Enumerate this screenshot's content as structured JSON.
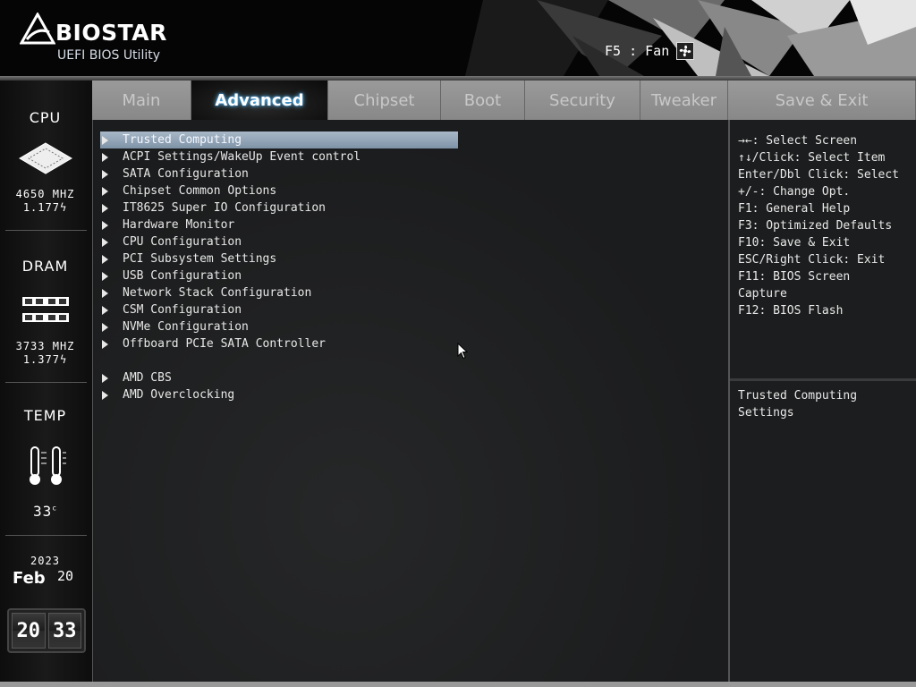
{
  "header": {
    "brand": "BIOSTAR",
    "subtitle": "UEFI BIOS Utility",
    "fan_hint": "F5 : Fan"
  },
  "status": {
    "cpu_label": "CPU",
    "cpu_freq": "4650 MHZ",
    "cpu_volt": "1.177",
    "dram_label": "DRAM",
    "dram_freq": "3733 MHZ",
    "dram_volt": "1.377",
    "temp_label": "TEMP",
    "temp_value": "33",
    "temp_unit": "c",
    "year": "2023",
    "month": "Feb",
    "day": "20",
    "hour": "20",
    "minute": "33"
  },
  "tabs": [
    {
      "label": "Main"
    },
    {
      "label": "Advanced"
    },
    {
      "label": "Chipset"
    },
    {
      "label": "Boot"
    },
    {
      "label": "Security"
    },
    {
      "label": "Tweaker"
    },
    {
      "label": "Save & Exit"
    }
  ],
  "active_tab": "Advanced",
  "menu": [
    {
      "label": "Trusted Computing",
      "selected": true
    },
    {
      "label": "ACPI Settings/WakeUp Event control"
    },
    {
      "label": "SATA Configuration"
    },
    {
      "label": "Chipset Common Options"
    },
    {
      "label": "IT8625 Super IO Configuration"
    },
    {
      "label": "Hardware Monitor"
    },
    {
      "label": "CPU Configuration"
    },
    {
      "label": "PCI Subsystem Settings"
    },
    {
      "label": "USB Configuration"
    },
    {
      "label": "Network Stack Configuration"
    },
    {
      "label": "CSM Configuration"
    },
    {
      "label": "NVMe Configuration"
    },
    {
      "label": "Offboard PCIe SATA Controller"
    },
    {
      "label": "AMD CBS"
    },
    {
      "label": "AMD Overclocking"
    }
  ],
  "help": {
    "keys": [
      "→←: Select Screen",
      "↑↓/Click: Select Item",
      "Enter/Dbl Click: Select",
      "+/-: Change Opt.",
      "F1: General Help",
      "F3: Optimized Defaults",
      "F10: Save & Exit",
      "ESC/Right Click: Exit",
      "F11: BIOS Screen",
      "Capture",
      "F12: BIOS Flash"
    ],
    "description_lines": [
      "Trusted Computing",
      "Settings"
    ]
  },
  "colors": {
    "selection": "#8fa2b6",
    "active_tab_glow": "#66ccff"
  }
}
